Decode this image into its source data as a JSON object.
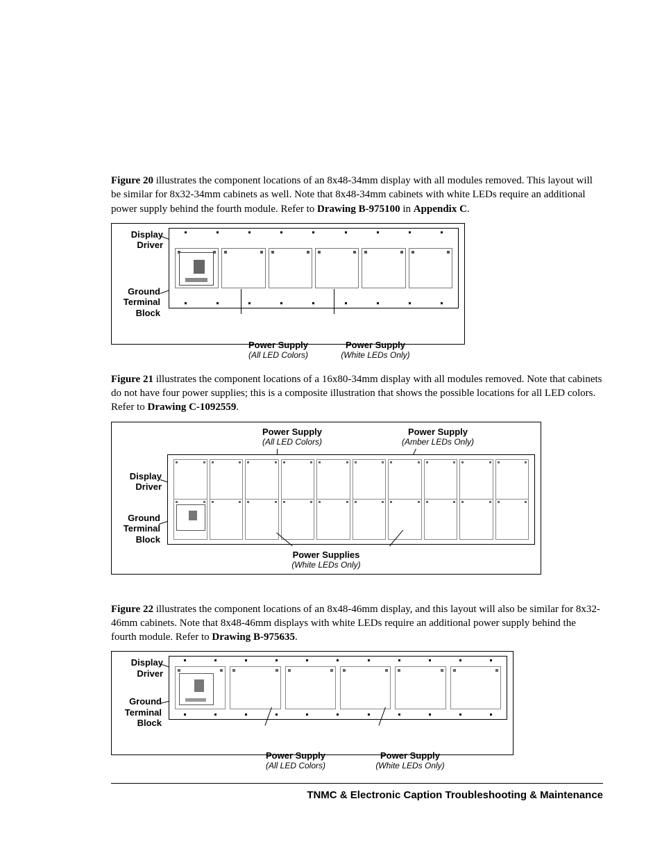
{
  "para1": {
    "fig": "Figure 20",
    "body1": " illustrates the component locations of an 8x48-34mm display with all modules removed. This layout will be similar for 8x32-34mm cabinets as well. Note that 8x48-34mm cabinets with white LEDs require an additional power supply behind the fourth module. Refer to ",
    "drawing": "Drawing B-975100",
    "in": " in ",
    "appendix": "Appendix C",
    "end": "."
  },
  "fig20": {
    "label_display_driver_1": "Display",
    "label_display_driver_2": "Driver",
    "label_ground_1": "Ground",
    "label_ground_2": "Terminal",
    "label_ground_3": "Block",
    "ps1_title": "Power Supply",
    "ps1_sub": "(All LED Colors)",
    "ps2_title": "Power Supply",
    "ps2_sub": "(White LEDs Only)"
  },
  "para2": {
    "fig": "Figure 21",
    "body1": " illustrates the component locations of a 16x80-34mm display with all modules removed. Note that cabinets do not have four power supplies; this is a composite illustration that shows the possible locations for all LED colors. Refer to ",
    "drawing": "Drawing C-1092559",
    "end": "."
  },
  "fig21": {
    "top1_title": "Power Supply",
    "top1_sub": "(All LED Colors)",
    "top2_title": "Power Supply",
    "top2_sub": "(Amber LEDs Only)",
    "label_display_driver_1": "Display",
    "label_display_driver_2": "Driver",
    "label_ground_1": "Ground",
    "label_ground_2": "Terminal",
    "label_ground_3": "Block",
    "bot_title": "Power Supplies",
    "bot_sub": "(White LEDs Only)"
  },
  "para3": {
    "fig": "Figure 22",
    "body1": " illustrates the component locations of an 8x48-46mm display, and this layout will also be similar for 8x32-46mm cabinets. Note that 8x48-46mm displays with white LEDs require an additional power supply behind the fourth module. Refer to ",
    "drawing": "Drawing B-975635",
    "end": "."
  },
  "fig22": {
    "label_display_driver_1": "Display",
    "label_display_driver_2": "Driver",
    "label_ground_1": "Ground",
    "label_ground_2": "Terminal",
    "label_ground_3": "Block",
    "ps1_title": "Power Supply",
    "ps1_sub": "(All LED Colors)",
    "ps2_title": "Power Supply",
    "ps2_sub": "(White LEDs Only)"
  },
  "footer": "TNMC & Electronic Caption Troubleshooting & Maintenance"
}
